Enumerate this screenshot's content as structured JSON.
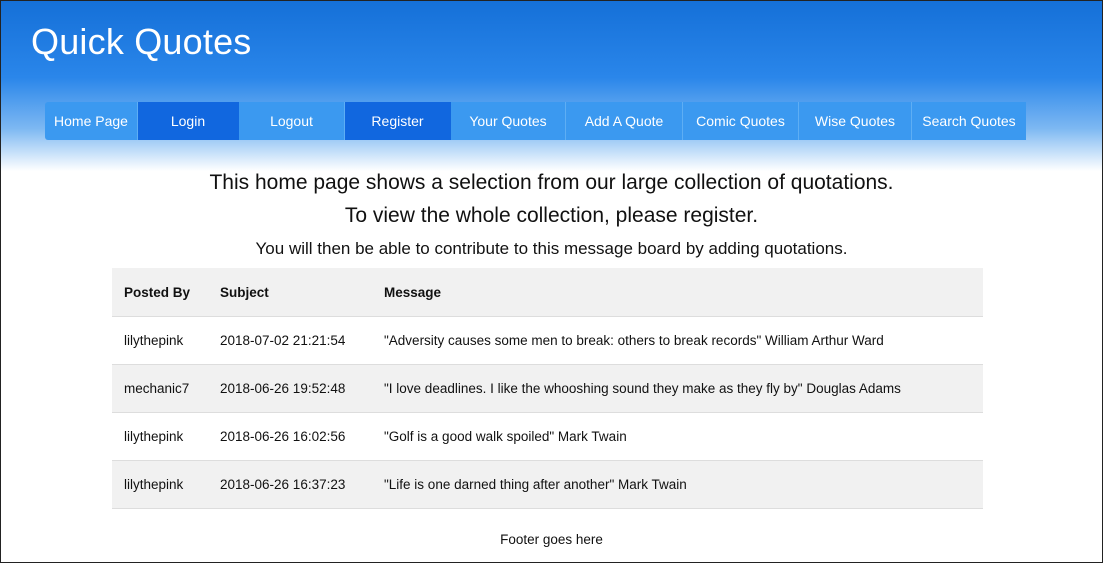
{
  "site": {
    "title": "Quick Quotes"
  },
  "nav": {
    "items": [
      {
        "label": "Home Page"
      },
      {
        "label": "Login"
      },
      {
        "label": "Logout"
      },
      {
        "label": "Register"
      },
      {
        "label": "Your Quotes"
      },
      {
        "label": "Add A Quote"
      },
      {
        "label": "Comic Quotes"
      },
      {
        "label": "Wise Quotes"
      },
      {
        "label": "Search Quotes"
      }
    ]
  },
  "intro": {
    "line1": "This home page shows a selection from our large collection of quotations.",
    "line2": "To view the whole collection, please register.",
    "line3": "You will then be able to contribute to this message board by adding quotations."
  },
  "table": {
    "headers": [
      "Posted By",
      "Subject",
      "Message"
    ],
    "rows": [
      [
        "lilythepink",
        "2018-07-02 21:21:54",
        "\"Adversity causes some men to break: others to break records\" William Arthur Ward"
      ],
      [
        "mechanic7",
        "2018-06-26 19:52:48",
        "\"I love deadlines. I like the whooshing sound they make as they fly by\" Douglas Adams"
      ],
      [
        "lilythepink",
        "2018-06-26 16:02:56",
        "\"Golf is a good walk spoiled\" Mark Twain"
      ],
      [
        "lilythepink",
        "2018-06-26 16:37:23",
        "\"Life is one darned thing after another\" Mark Twain"
      ]
    ]
  },
  "footer": {
    "text": "Footer goes here"
  },
  "colors": {
    "nav_light": "#3b99f0",
    "nav_dark": "#1167df",
    "header_top": "#1570d8",
    "row_alt": "#f1f1f1"
  }
}
